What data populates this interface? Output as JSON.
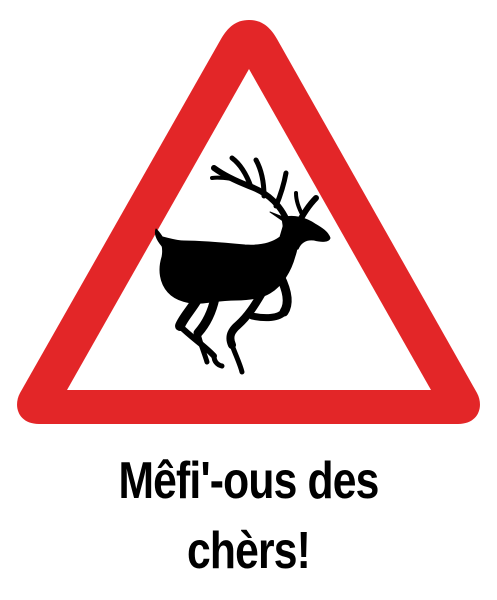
{
  "sign": {
    "border_color": "#e32628",
    "background_color": "#ffffff",
    "symbol_color": "#000000",
    "symbol_icon": "running-deer-silhouette"
  },
  "caption": {
    "line1": "Mêfi'-ous des",
    "line2": "chèrs!"
  }
}
